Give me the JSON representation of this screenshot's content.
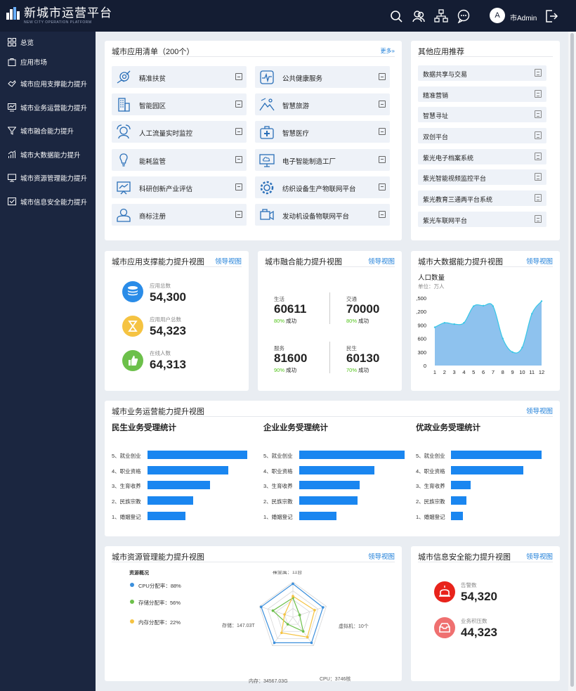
{
  "app": {
    "logo_text": "新城市运营平台",
    "logo_sub": "NEW CITY OPERATION PLATFORM",
    "user_initial": "A",
    "user_name": "市Admin"
  },
  "topbar": {
    "icons": [
      "search-icon",
      "users-icon",
      "hierarchy-icon",
      "chat-icon",
      "logout-icon"
    ]
  },
  "sidebar": {
    "items": [
      {
        "label": "总览",
        "icon": "grid-icon"
      },
      {
        "label": "应用市场",
        "icon": "bag-icon"
      },
      {
        "label": "城市应用支撑能力提升",
        "icon": "handshake-icon"
      },
      {
        "label": "城市业务运营能力提升",
        "icon": "chart-monitor-icon"
      },
      {
        "label": "城市融合能力提升",
        "icon": "funnel-icon"
      },
      {
        "label": "城市大数据能力提升",
        "icon": "bar-growth-icon"
      },
      {
        "label": "城市资源管理能力提升",
        "icon": "monitor-icon"
      },
      {
        "label": "城市信息安全能力提升",
        "icon": "shield-check-icon"
      }
    ]
  },
  "apps_panel": {
    "title": "城市应用清单（200个）",
    "more": "更多»",
    "items": [
      {
        "label": "精准扶贫",
        "icon": "target-hand-icon"
      },
      {
        "label": "公共健康服务",
        "icon": "heartbeat-icon"
      },
      {
        "label": "智能园区",
        "icon": "building-icon"
      },
      {
        "label": "智慧旅游",
        "icon": "mountain-icon"
      },
      {
        "label": "人工流量实时监控",
        "icon": "face-scan-icon"
      },
      {
        "label": "智慧医疗",
        "icon": "medical-kit-icon"
      },
      {
        "label": "能耗监管",
        "icon": "bulb-icon"
      },
      {
        "label": "电子智能制造工厂",
        "icon": "monitor-cloud-icon"
      },
      {
        "label": "科研创新产业评估",
        "icon": "presentation-icon"
      },
      {
        "label": "纺织设备生产物联网平台",
        "icon": "gear-icon"
      },
      {
        "label": "商标注册",
        "icon": "person-icon"
      },
      {
        "label": "发动机设备物联网平台",
        "icon": "engine-icon"
      }
    ]
  },
  "recommend": {
    "title": "其他应用推荐",
    "items": [
      "数据共享与交易",
      "精准营销",
      "智慧寻址",
      "双创平台",
      "紫光电子档案系统",
      "紫光智能视频监控平台",
      "紫光教育三通两平台系统",
      "紫光车联网平台"
    ]
  },
  "support": {
    "title": "城市应用支撑能力提升视图",
    "link": "领导视图",
    "stats": [
      {
        "label": "应用总数",
        "value": "54,300",
        "color": "#2a8ce8",
        "icon": "database-icon"
      },
      {
        "label": "应用用户总数",
        "value": "54,323",
        "color": "#f5c342",
        "icon": "hourglass-icon"
      },
      {
        "label": "在线人数",
        "value": "64,313",
        "color": "#6cc04a",
        "icon": "thumbs-up-icon"
      }
    ]
  },
  "fusion": {
    "title": "城市融合能力提升视图",
    "link": "领导视图",
    "cells": [
      {
        "label": "生活",
        "value": "60611",
        "pct": "80%",
        "suffix": "成功"
      },
      {
        "label": "交通",
        "value": "70000",
        "pct": "80%",
        "suffix": "成功"
      },
      {
        "label": "服务",
        "value": "81600",
        "pct": "90%",
        "suffix": "成功"
      },
      {
        "label": "民生",
        "value": "60130",
        "pct": "70%",
        "suffix": "成功"
      }
    ]
  },
  "bigdata": {
    "title": "城市大数据能力提升视图",
    "link": "领导视图",
    "chart_title": "人口数量",
    "unit": "单位：万人"
  },
  "business": {
    "title": "城市业务运营能力提升视图",
    "link": "领导视图",
    "groups": [
      {
        "title": "民生业务受理统计"
      },
      {
        "title": "企业业务受理统计"
      },
      {
        "title": "优政业务受理统计"
      }
    ]
  },
  "resource": {
    "title": "城市资源管理能力提升视图",
    "link": "领导视图",
    "legend_title": "资源概况",
    "legend": [
      {
        "label": "CPU分配率：88%",
        "color": "#3b8fdc"
      },
      {
        "label": "存储分配率：56%",
        "color": "#6cc04a"
      },
      {
        "label": "内存分配率：22%",
        "color": "#f5c342"
      }
    ],
    "axis_labels": [
      "裸金属：11台",
      "虚拟机：10个",
      "CPU：3746核",
      "内存：34567.03G",
      "存储：147.03T"
    ]
  },
  "security": {
    "title": "城市信息安全能力提升视图",
    "link": "领导视图",
    "stats": [
      {
        "label": "告警数",
        "value": "54,320",
        "icon": "alarm-icon"
      },
      {
        "label": "业务积压数",
        "value": "44,323",
        "icon": "inbox-icon"
      }
    ]
  },
  "chart_data": [
    {
      "type": "area",
      "title": "人口数量",
      "ylabel": "单位：万人",
      "x": [
        1,
        2,
        3,
        4,
        5,
        6,
        7,
        8,
        9,
        10,
        11,
        12
      ],
      "values": [
        850,
        950,
        920,
        950,
        1320,
        1330,
        1320,
        600,
        300,
        400,
        1150,
        1430
      ],
      "yticks": [
        "0",
        "300",
        "600",
        "900",
        ",200",
        ",500"
      ],
      "ylim": [
        0,
        1500
      ]
    },
    {
      "type": "bar",
      "title": "民生业务受理统计",
      "categories": [
        "5、就业创业",
        "4、职业资格",
        "3、生育收养",
        "2、民族宗教",
        "1、婚姻登记"
      ],
      "values": [
        100,
        81,
        63,
        46,
        38
      ]
    },
    {
      "type": "bar",
      "title": "企业业务受理统计",
      "categories": [
        "5、就业创业",
        "4、职业资格",
        "3、生育收养",
        "2、民族宗教",
        "1、婚姻登记"
      ],
      "values": [
        100,
        71,
        57,
        55,
        35
      ]
    },
    {
      "type": "bar",
      "title": "优政业务受理统计",
      "categories": [
        "5、就业创业",
        "4、职业资格",
        "3、生育收养",
        "2、民族宗教",
        "1、婚姻登记"
      ],
      "values": [
        100,
        80,
        22,
        17,
        13
      ]
    },
    {
      "type": "radar",
      "title": "资源概况",
      "axes": [
        "裸金属：11台",
        "虚拟机：10个",
        "CPU：3746核",
        "内存：34567.03G",
        "存储：147.03T"
      ],
      "series": [
        {
          "name": "CPU分配率：88%",
          "values": [
            0.95,
            0.9,
            0.9,
            0.9,
            0.95
          ]
        },
        {
          "name": "存储分配率：56%",
          "values": [
            0.55,
            0.2,
            0.5,
            0.25,
            0.6
          ]
        },
        {
          "name": "内存分配率：22%",
          "values": [
            0.6,
            0.65,
            0.7,
            0.55,
            0.25
          ]
        }
      ]
    }
  ]
}
